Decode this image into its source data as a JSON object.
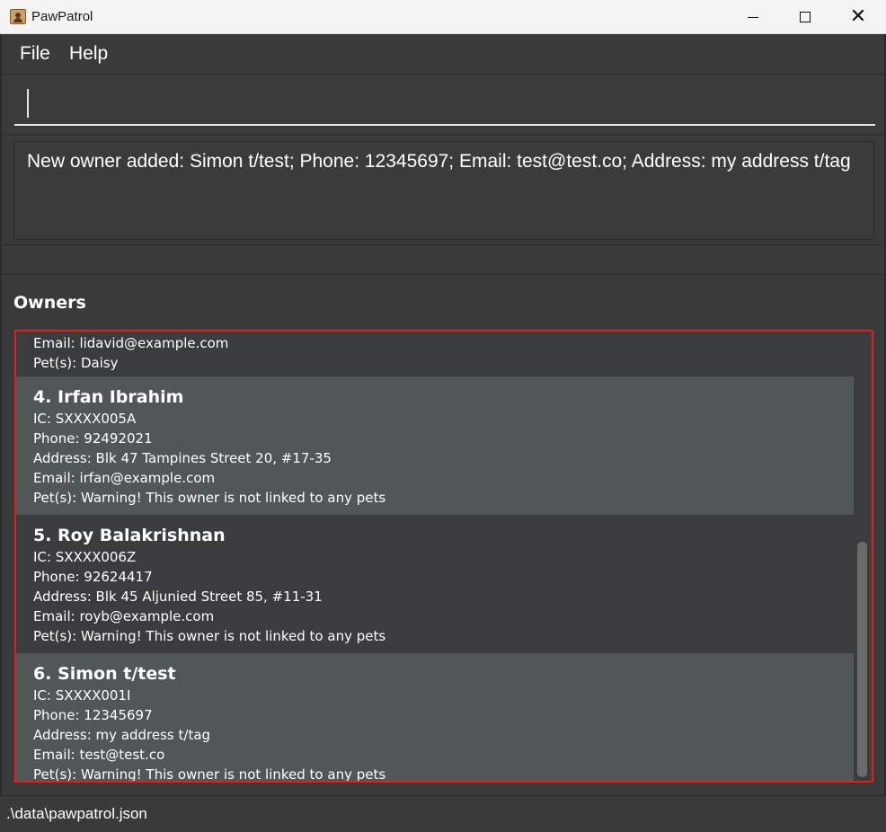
{
  "window": {
    "title": "PawPatrol",
    "minimize_label": "—",
    "close_glyph": "✕"
  },
  "menu": {
    "file": "File",
    "help": "Help"
  },
  "command": {
    "value": "",
    "placeholder": ""
  },
  "result": {
    "message": "New owner added: Simon t/test; Phone: 12345697; Email: test@test.co; Address: my address t/tag"
  },
  "owners": {
    "title": "Owners",
    "partial_top": {
      "email": "Email: lidavid@example.com",
      "pets": "Pet(s): Daisy"
    },
    "items": [
      {
        "name": "4. Irfan Ibrahim",
        "ic": "IC: SXXXX005A",
        "phone": "Phone: 92492021",
        "address": "Address: Blk 47 Tampines Street 20, #17-35",
        "email": "Email: irfan@example.com",
        "pets": "Pet(s): Warning! This owner is not linked to any pets"
      },
      {
        "name": "5. Roy Balakrishnan",
        "ic": "IC: SXXXX006Z",
        "phone": "Phone: 92624417",
        "address": "Address: Blk 45 Aljunied Street 85, #11-31",
        "email": "Email: royb@example.com",
        "pets": "Pet(s): Warning! This owner is not linked to any pets"
      },
      {
        "name": "6. Simon t/test",
        "ic": "IC: SXXXX001I",
        "phone": "Phone: 12345697",
        "address": "Address: my address t/tag",
        "email": "Email: test@test.co",
        "pets": "Pet(s): Warning! This owner is not linked to any pets"
      }
    ]
  },
  "status": {
    "file_path": ".\\data\\pawpatrol.json"
  },
  "colors": {
    "background": "#3a3a3a",
    "card_alt": "#515658",
    "selection_border": "#e02020",
    "titlebar": "#f3f3f3"
  }
}
